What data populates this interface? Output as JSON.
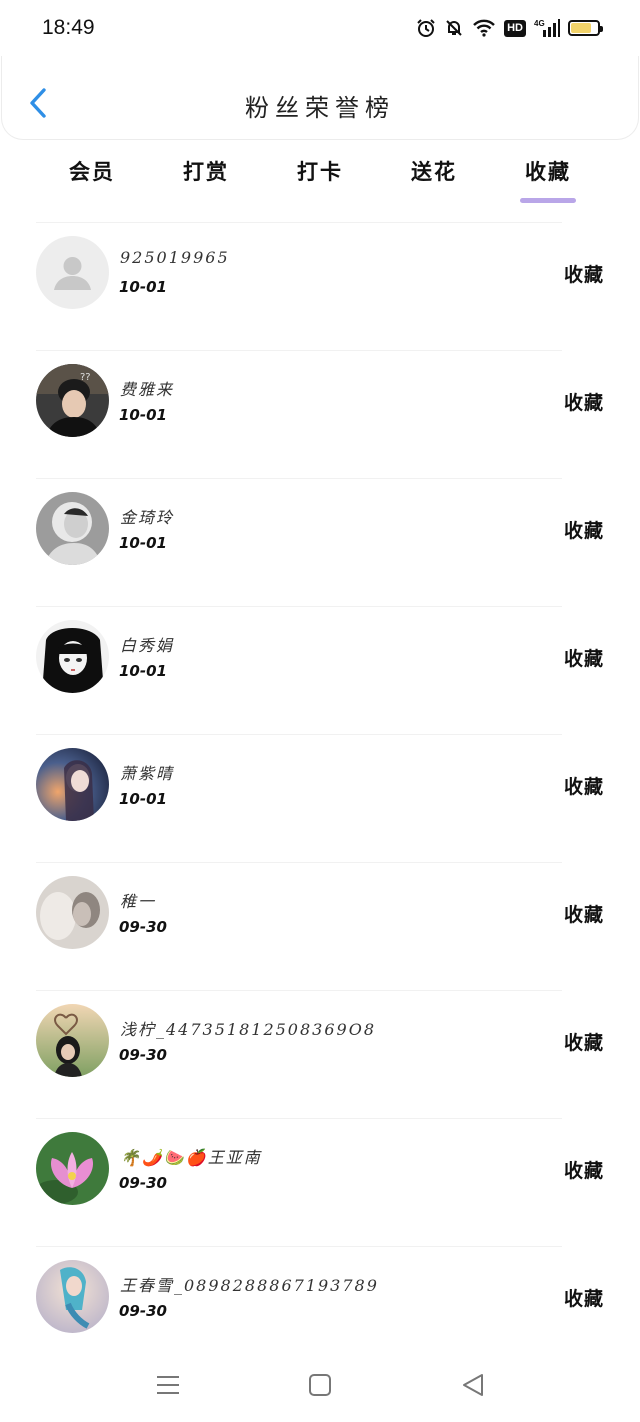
{
  "status": {
    "time": "18:49",
    "hd": "HD",
    "network": "4G",
    "battery_level": 0.78
  },
  "header": {
    "title": "粉丝荣誉榜"
  },
  "tabs": [
    {
      "label": "会员",
      "active": false
    },
    {
      "label": "打赏",
      "active": false
    },
    {
      "label": "打卡",
      "active": false
    },
    {
      "label": "送花",
      "active": false
    },
    {
      "label": "收藏",
      "active": true
    }
  ],
  "colors": {
    "accent": "#b9a6e8",
    "back": "#2f8fe6"
  },
  "rows": [
    {
      "name": "925019965",
      "date": "10-01",
      "action": "收藏",
      "avatar": "default-avatar"
    },
    {
      "name": "费雅来",
      "date": "10-01",
      "action": "收藏",
      "avatar": "boy-photo"
    },
    {
      "name": "金琦玲",
      "date": "10-01",
      "action": "收藏",
      "avatar": "grey-portrait"
    },
    {
      "name": "白秀娟",
      "date": "10-01",
      "action": "收藏",
      "avatar": "anime-girl"
    },
    {
      "name": "萧紫晴",
      "date": "10-01",
      "action": "收藏",
      "avatar": "fantasy-girl"
    },
    {
      "name": "稚一",
      "date": "09-30",
      "action": "收藏",
      "avatar": "soft-portrait"
    },
    {
      "name": "浅柠_447351812508369O8",
      "date": "09-30",
      "action": "收藏",
      "avatar": "heart-girl"
    },
    {
      "name": "🌴🌶️🍉🍎王亚南",
      "date": "09-30",
      "action": "收藏",
      "avatar": "lotus-flower"
    },
    {
      "name": "王春雪_0898288867193789",
      "date": "09-30",
      "action": "收藏",
      "avatar": "mermaid-art"
    }
  ],
  "nav": {
    "menu": "menu-icon",
    "home": "home-icon",
    "back": "back-icon"
  }
}
